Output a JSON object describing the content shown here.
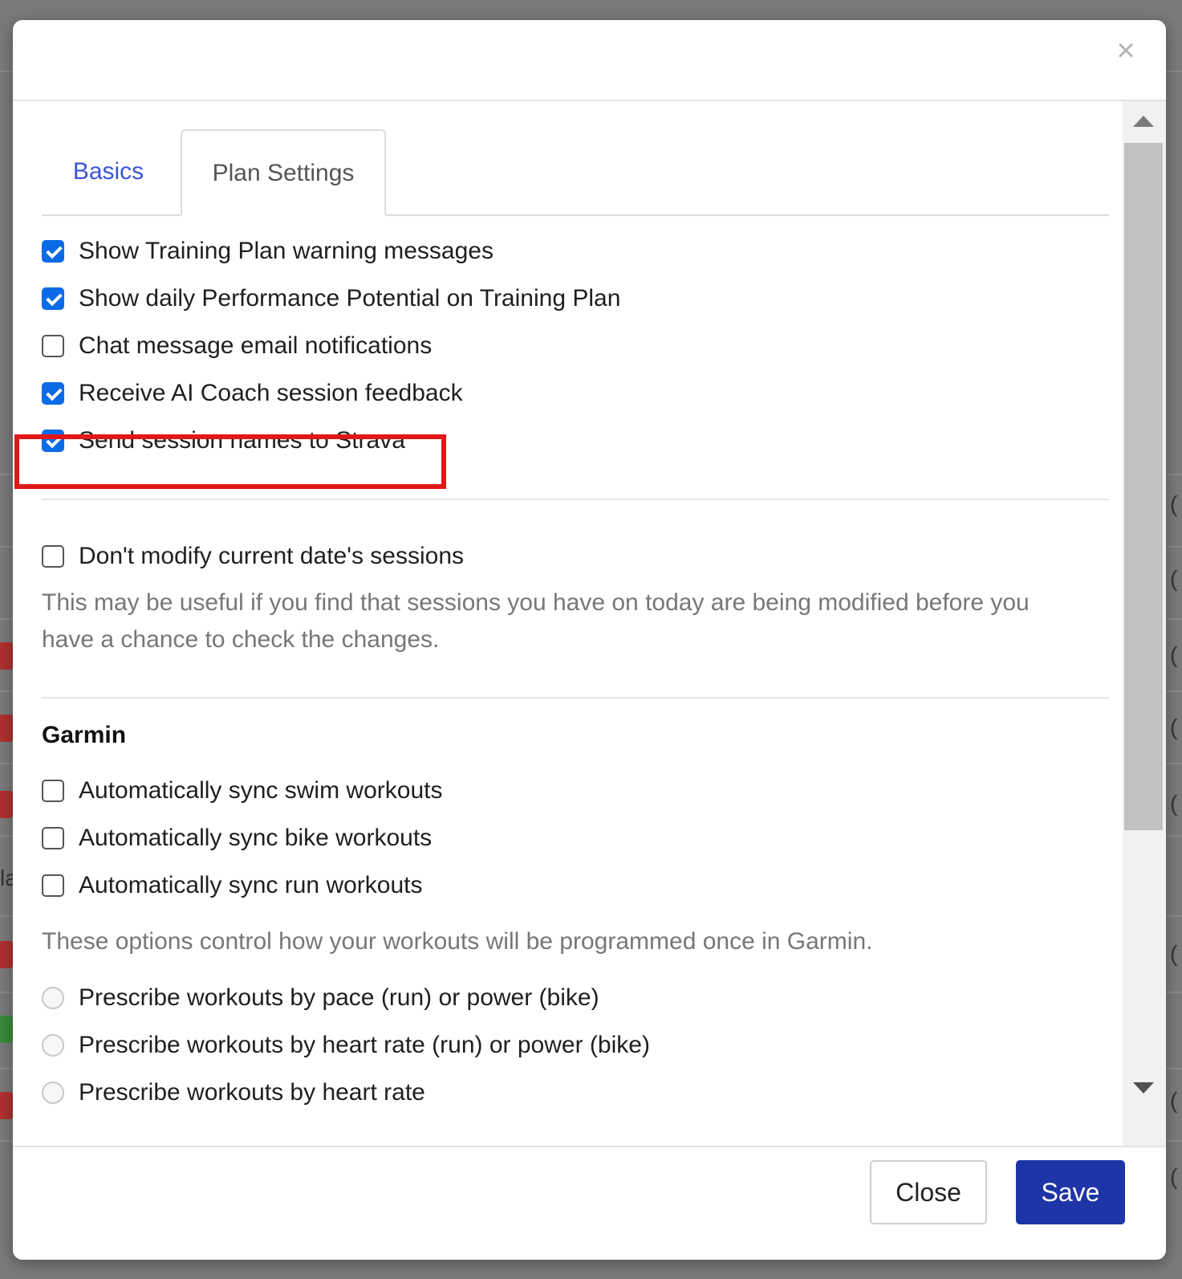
{
  "background": {
    "paren_glyph": "(",
    "partial_letter": "la"
  },
  "modal": {
    "close_glyph": "×",
    "tabs": [
      {
        "label": "Basics",
        "active": false
      },
      {
        "label": "Plan Settings",
        "active": true
      }
    ],
    "settings": [
      {
        "label": "Show Training Plan warning messages",
        "checked": true
      },
      {
        "label": "Show daily Performance Potential on Training Plan",
        "checked": true
      },
      {
        "label": "Chat message email notifications",
        "checked": false
      },
      {
        "label": "Receive AI Coach session feedback",
        "checked": true
      },
      {
        "label": "Send session names to Strava",
        "checked": true
      }
    ],
    "dont_modify": {
      "label": "Don't modify current date's sessions",
      "checked": false,
      "help_line1": "This may be useful if you find that sessions you have on today are being modified before you",
      "help_line2": "have a chance to check the changes."
    },
    "garmin": {
      "title": "Garmin",
      "sync": [
        {
          "label": "Automatically sync swim workouts",
          "checked": false
        },
        {
          "label": "Automatically sync bike workouts",
          "checked": false
        },
        {
          "label": "Automatically sync run workouts",
          "checked": false
        }
      ],
      "help": "These options control how your workouts will be programmed once in Garmin.",
      "prescribe": [
        {
          "label": "Prescribe workouts by pace (run) or power (bike)",
          "selected": false
        },
        {
          "label": "Prescribe workouts by heart rate (run) or power (bike)",
          "selected": false
        },
        {
          "label": "Prescribe workouts by heart rate",
          "selected": false
        }
      ]
    },
    "footer": {
      "close_label": "Close",
      "save_label": "Save"
    }
  },
  "colors": {
    "accent_blue": "#0b6be6",
    "tab_link": "#3a56d4",
    "save_button": "#1e35a8",
    "highlight_red": "#e01818",
    "tag_red": "#b03030",
    "tag_green": "#3a8a3a"
  }
}
